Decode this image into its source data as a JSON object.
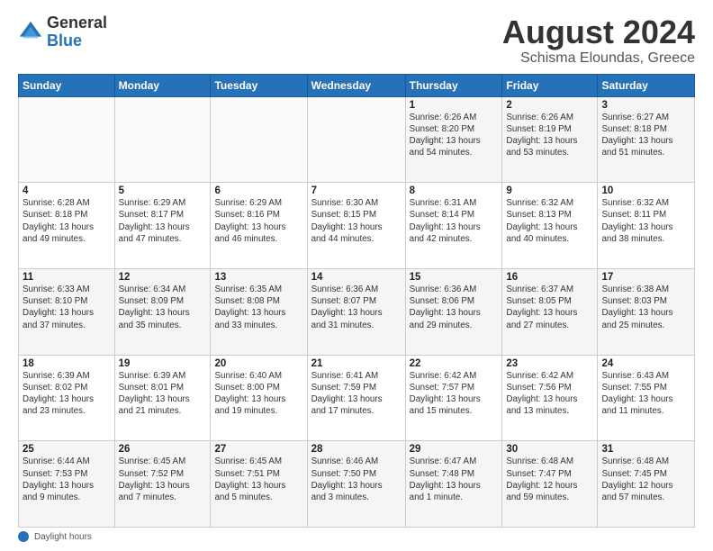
{
  "logo": {
    "general": "General",
    "blue": "Blue"
  },
  "title": "August 2024",
  "subtitle": "Schisma Eloundas, Greece",
  "weekdays": [
    "Sunday",
    "Monday",
    "Tuesday",
    "Wednesday",
    "Thursday",
    "Friday",
    "Saturday"
  ],
  "weeks": [
    [
      {
        "day": "",
        "info": ""
      },
      {
        "day": "",
        "info": ""
      },
      {
        "day": "",
        "info": ""
      },
      {
        "day": "",
        "info": ""
      },
      {
        "day": "1",
        "info": "Sunrise: 6:26 AM\nSunset: 8:20 PM\nDaylight: 13 hours\nand 54 minutes."
      },
      {
        "day": "2",
        "info": "Sunrise: 6:26 AM\nSunset: 8:19 PM\nDaylight: 13 hours\nand 53 minutes."
      },
      {
        "day": "3",
        "info": "Sunrise: 6:27 AM\nSunset: 8:18 PM\nDaylight: 13 hours\nand 51 minutes."
      }
    ],
    [
      {
        "day": "4",
        "info": "Sunrise: 6:28 AM\nSunset: 8:18 PM\nDaylight: 13 hours\nand 49 minutes."
      },
      {
        "day": "5",
        "info": "Sunrise: 6:29 AM\nSunset: 8:17 PM\nDaylight: 13 hours\nand 47 minutes."
      },
      {
        "day": "6",
        "info": "Sunrise: 6:29 AM\nSunset: 8:16 PM\nDaylight: 13 hours\nand 46 minutes."
      },
      {
        "day": "7",
        "info": "Sunrise: 6:30 AM\nSunset: 8:15 PM\nDaylight: 13 hours\nand 44 minutes."
      },
      {
        "day": "8",
        "info": "Sunrise: 6:31 AM\nSunset: 8:14 PM\nDaylight: 13 hours\nand 42 minutes."
      },
      {
        "day": "9",
        "info": "Sunrise: 6:32 AM\nSunset: 8:13 PM\nDaylight: 13 hours\nand 40 minutes."
      },
      {
        "day": "10",
        "info": "Sunrise: 6:32 AM\nSunset: 8:11 PM\nDaylight: 13 hours\nand 38 minutes."
      }
    ],
    [
      {
        "day": "11",
        "info": "Sunrise: 6:33 AM\nSunset: 8:10 PM\nDaylight: 13 hours\nand 37 minutes."
      },
      {
        "day": "12",
        "info": "Sunrise: 6:34 AM\nSunset: 8:09 PM\nDaylight: 13 hours\nand 35 minutes."
      },
      {
        "day": "13",
        "info": "Sunrise: 6:35 AM\nSunset: 8:08 PM\nDaylight: 13 hours\nand 33 minutes."
      },
      {
        "day": "14",
        "info": "Sunrise: 6:36 AM\nSunset: 8:07 PM\nDaylight: 13 hours\nand 31 minutes."
      },
      {
        "day": "15",
        "info": "Sunrise: 6:36 AM\nSunset: 8:06 PM\nDaylight: 13 hours\nand 29 minutes."
      },
      {
        "day": "16",
        "info": "Sunrise: 6:37 AM\nSunset: 8:05 PM\nDaylight: 13 hours\nand 27 minutes."
      },
      {
        "day": "17",
        "info": "Sunrise: 6:38 AM\nSunset: 8:03 PM\nDaylight: 13 hours\nand 25 minutes."
      }
    ],
    [
      {
        "day": "18",
        "info": "Sunrise: 6:39 AM\nSunset: 8:02 PM\nDaylight: 13 hours\nand 23 minutes."
      },
      {
        "day": "19",
        "info": "Sunrise: 6:39 AM\nSunset: 8:01 PM\nDaylight: 13 hours\nand 21 minutes."
      },
      {
        "day": "20",
        "info": "Sunrise: 6:40 AM\nSunset: 8:00 PM\nDaylight: 13 hours\nand 19 minutes."
      },
      {
        "day": "21",
        "info": "Sunrise: 6:41 AM\nSunset: 7:59 PM\nDaylight: 13 hours\nand 17 minutes."
      },
      {
        "day": "22",
        "info": "Sunrise: 6:42 AM\nSunset: 7:57 PM\nDaylight: 13 hours\nand 15 minutes."
      },
      {
        "day": "23",
        "info": "Sunrise: 6:42 AM\nSunset: 7:56 PM\nDaylight: 13 hours\nand 13 minutes."
      },
      {
        "day": "24",
        "info": "Sunrise: 6:43 AM\nSunset: 7:55 PM\nDaylight: 13 hours\nand 11 minutes."
      }
    ],
    [
      {
        "day": "25",
        "info": "Sunrise: 6:44 AM\nSunset: 7:53 PM\nDaylight: 13 hours\nand 9 minutes."
      },
      {
        "day": "26",
        "info": "Sunrise: 6:45 AM\nSunset: 7:52 PM\nDaylight: 13 hours\nand 7 minutes."
      },
      {
        "day": "27",
        "info": "Sunrise: 6:45 AM\nSunset: 7:51 PM\nDaylight: 13 hours\nand 5 minutes."
      },
      {
        "day": "28",
        "info": "Sunrise: 6:46 AM\nSunset: 7:50 PM\nDaylight: 13 hours\nand 3 minutes."
      },
      {
        "day": "29",
        "info": "Sunrise: 6:47 AM\nSunset: 7:48 PM\nDaylight: 13 hours\nand 1 minute."
      },
      {
        "day": "30",
        "info": "Sunrise: 6:48 AM\nSunset: 7:47 PM\nDaylight: 12 hours\nand 59 minutes."
      },
      {
        "day": "31",
        "info": "Sunrise: 6:48 AM\nSunset: 7:45 PM\nDaylight: 12 hours\nand 57 minutes."
      }
    ]
  ],
  "footer": {
    "note": "Daylight hours"
  }
}
